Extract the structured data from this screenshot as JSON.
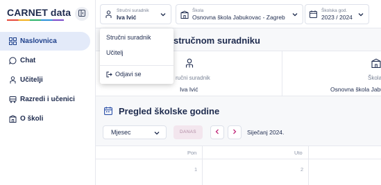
{
  "app": {
    "brand": "CARNET data",
    "colors": {
      "accent": "#1d3f8a",
      "active_bg": "#e3eaf9",
      "today_bg": "#f3e6ee",
      "today_text": "#b08aa4"
    }
  },
  "sidebar": {
    "items": [
      {
        "label": "Naslovnica",
        "icon": "grid-icon",
        "active": true
      },
      {
        "label": "Chat",
        "icon": "chat-icon",
        "active": false
      },
      {
        "label": "Učitelji",
        "icon": "person-icon",
        "active": false
      },
      {
        "label": "Razredi i učenici",
        "icon": "bus-icon",
        "active": false
      },
      {
        "label": "O školi",
        "icon": "school-icon",
        "active": false
      }
    ]
  },
  "topbar": {
    "role": {
      "label": "Stručni suradnik",
      "value": "Iva Ivić"
    },
    "school": {
      "label": "Škola",
      "value": "Osnovna škola Jabukovac - Zagreb"
    },
    "year": {
      "label": "Školska god.",
      "value": "2023 / 2024"
    }
  },
  "role_menu": {
    "items": [
      "Stručni suradnik",
      "Učitelj"
    ],
    "logout": "Odjavi se"
  },
  "main": {
    "info_title": "stručnom suradniku",
    "info_cards": [
      {
        "label": "ručni suradnik",
        "value": "Iva Ivić",
        "icon": "person-icon"
      },
      {
        "label": "Škola",
        "value": "Osnovna škola Jabu",
        "icon": "school-icon"
      }
    ],
    "calendar": {
      "title": "Pregled školske godine",
      "view_select": "Mjesec",
      "today_label": "DANAS",
      "month_label": "Siječanj 2024.",
      "days": [
        {
          "name": "Pon",
          "number": "1"
        },
        {
          "name": "Uto",
          "number": "2"
        }
      ]
    }
  }
}
